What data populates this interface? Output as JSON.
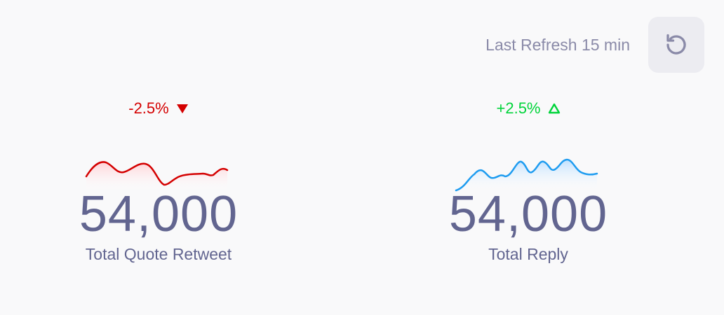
{
  "header": {
    "refresh_label": "Last Refresh 15 min",
    "refresh_icon": "refresh-icon"
  },
  "stats": [
    {
      "trend_text": "-2.5%",
      "trend_direction": "down",
      "trend_icon": "triangle-down-icon",
      "trend_color": "#d40000",
      "value": "54,000",
      "label": "Total Quote Retweet",
      "sparkline_color": "#d40000",
      "sparkline_fill": "#ffd6d9"
    },
    {
      "trend_text": "+2.5%",
      "trend_direction": "up",
      "trend_icon": "triangle-up-outline-icon",
      "trend_color": "#00d43a",
      "value": "54,000",
      "label": "Total Reply",
      "sparkline_color": "#1e9cf0",
      "sparkline_fill": "#cfe8ff"
    }
  ],
  "colors": {
    "background": "#f9f9fa",
    "text_primary": "#626590",
    "text_muted": "#8a8aa8",
    "button_bg": "#ececf1"
  }
}
